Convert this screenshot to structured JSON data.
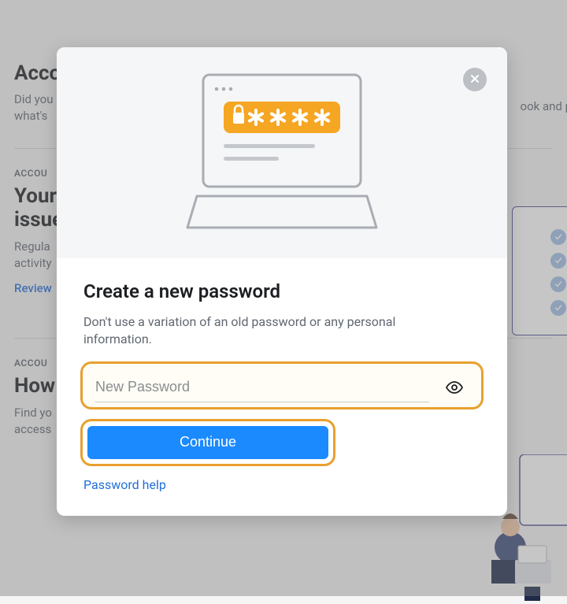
{
  "background": {
    "heading1": "Acco",
    "body1_line1": "Did you",
    "body1_line2": "what's",
    "body1_right": "ook and p",
    "kicker1": "ACCOU",
    "subheading1_line1": "Your",
    "subheading1_line2": "issue",
    "body2_line1": "Regula",
    "body2_line2": "activity",
    "link1": "Review",
    "kicker2": "ACCOU",
    "subheading2": "How",
    "body3_line1": "Find yo",
    "body3_line2": "access"
  },
  "modal": {
    "title": "Create a new password",
    "description": "Don't use a variation of an old password or any personal information.",
    "input_placeholder": "New Password",
    "continue_label": "Continue",
    "help_label": "Password help"
  }
}
